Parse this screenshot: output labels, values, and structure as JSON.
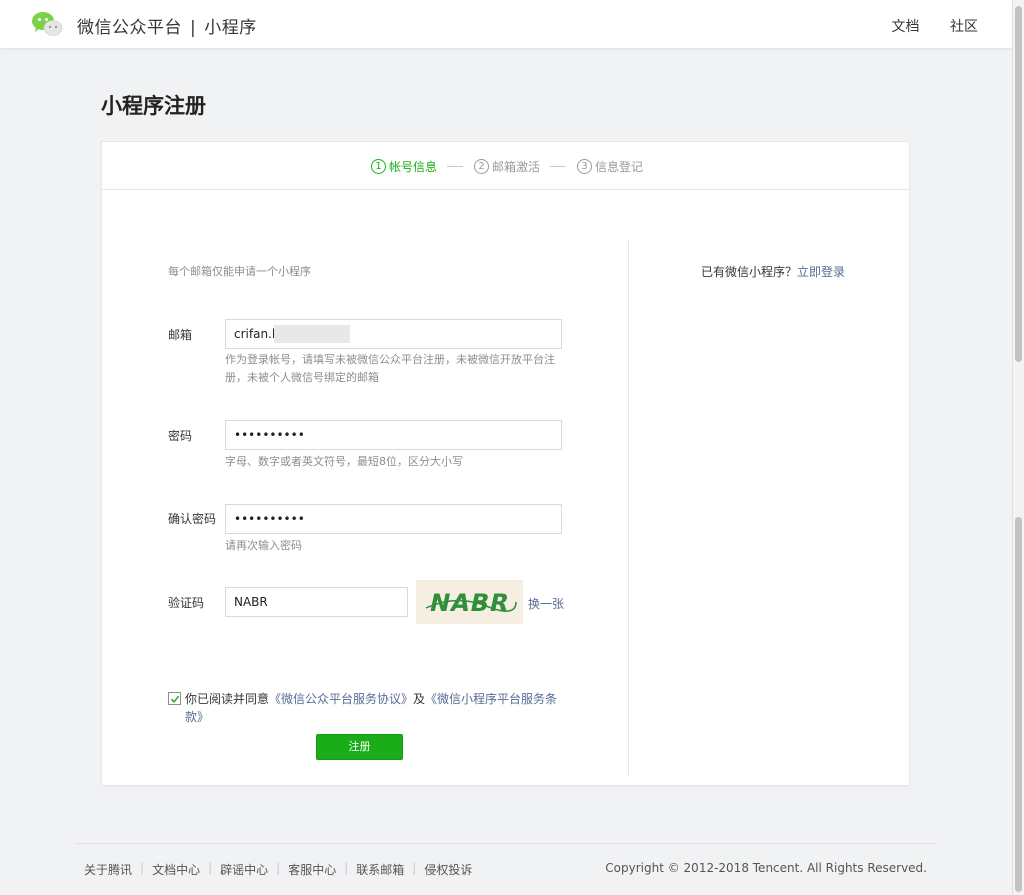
{
  "header": {
    "brand_name": "微信公众平台",
    "brand_separator": "|",
    "brand_product": "小程序",
    "nav": [
      "文档",
      "社区"
    ]
  },
  "page": {
    "title": "小程序注册"
  },
  "steps": [
    {
      "num": "1",
      "label": "帐号信息",
      "active": true
    },
    {
      "num": "2",
      "label": "邮箱激活",
      "active": false
    },
    {
      "num": "3",
      "label": "信息登记",
      "active": false
    }
  ],
  "form": {
    "tip": "每个邮箱仅能申请一个小程序",
    "email": {
      "label": "邮箱",
      "value": "crifan.li@",
      "hint": "作为登录帐号，请填写未被微信公众平台注册，未被微信开放平台注册，未被个人微信号绑定的邮箱"
    },
    "password": {
      "label": "密码",
      "value": "••••••••••",
      "hint": "字母、数字或者英文符号，最短8位，区分大小写"
    },
    "confirm": {
      "label": "确认密码",
      "value": "••••••••••",
      "hint": "请再次输入密码"
    },
    "captcha": {
      "label": "验证码",
      "value": "NABR",
      "image_text": "NABR",
      "refresh": "换一张"
    },
    "agreement": {
      "prefix": "你已阅读并同意",
      "link1": "《微信公众平台服务协议》",
      "join": "及",
      "link2": "《微信小程序平台服务条款》",
      "checked": true
    },
    "submit": "注册"
  },
  "side": {
    "question": "已有微信小程序？",
    "login_link": "立即登录"
  },
  "footer": {
    "links": [
      "关于腾讯",
      "文档中心",
      "辟谣中心",
      "客服中心",
      "联系邮箱",
      "侵权投诉"
    ],
    "copyright": "Copyright © 2012-2018 Tencent. All Rights Reserved."
  },
  "colors": {
    "accent": "#1aad19",
    "link": "#576b95",
    "background": "#f1f2f4"
  }
}
